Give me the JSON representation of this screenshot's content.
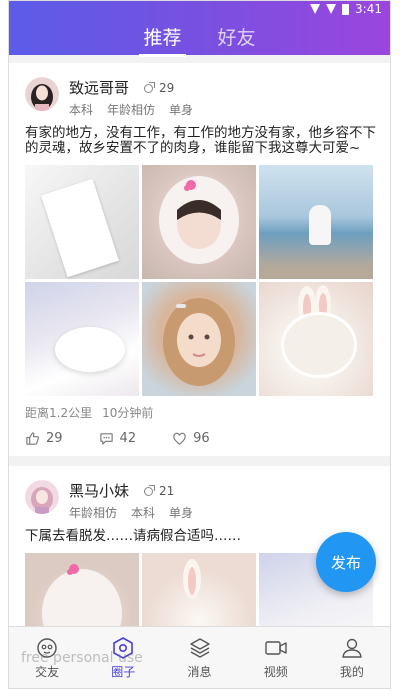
{
  "status": {
    "time": "3:41"
  },
  "tabs": [
    {
      "label": "推荐",
      "active": true
    },
    {
      "label": "好友",
      "active": false
    }
  ],
  "posts": [
    {
      "name": "致远哥哥",
      "age": "29",
      "tags": [
        "本科",
        "年龄相仿",
        "单身"
      ],
      "text": "有家的地方，没有工作，有工作的地方没有家，他乡容不下的灵魂，故乡安置不了的肉身，谁能留下我这尊大可爱~",
      "distance": "距离1.2公里",
      "time": "10分钟前",
      "likes": "29",
      "comments": "42",
      "favorites": "96"
    },
    {
      "name": "黑马小妹",
      "age": "21",
      "tags": [
        "年龄相仿",
        "本科",
        "单身"
      ],
      "text": "下属去看脱发……请病假合适吗……"
    }
  ],
  "fab": {
    "label": "发布"
  },
  "nav": [
    {
      "label": "交友",
      "icon": "face-icon"
    },
    {
      "label": "圈子",
      "icon": "hexagon-icon",
      "active": true
    },
    {
      "label": "消息",
      "icon": "layers-icon"
    },
    {
      "label": "视频",
      "icon": "video-icon"
    },
    {
      "label": "我的",
      "icon": "user-icon"
    }
  ],
  "colors": {
    "header_start": "#5b5ce8",
    "header_end": "#9b46de",
    "fab": "#2196f3",
    "nav_active": "#4a3fd8"
  },
  "watermark": "free personal use"
}
